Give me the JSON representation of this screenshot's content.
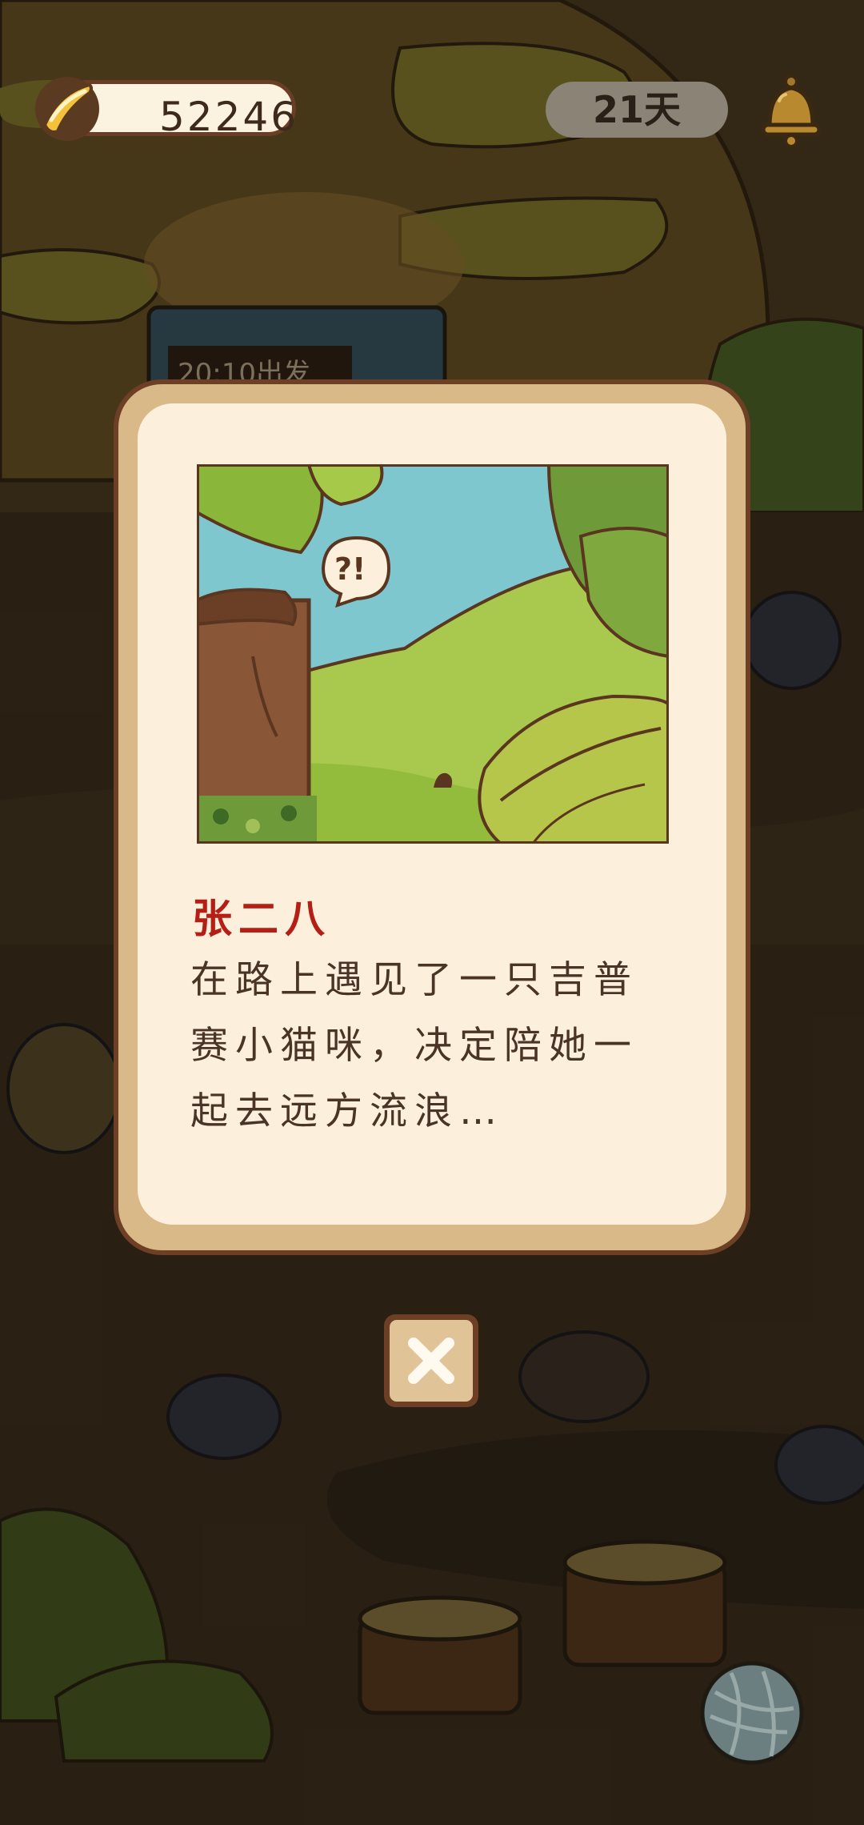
{
  "hud": {
    "banana_count": "52246",
    "days_label": "21天"
  },
  "background": {
    "partial_sign_text": "20:10出发"
  },
  "dialog": {
    "character_name": "张二八",
    "story_lines": [
      "在路上遇见了一只吉普",
      "赛小猫咪，决定陪她一",
      "起去远方流浪…"
    ],
    "speech_bubble_text": "?!"
  },
  "icons": {
    "banana": "banana-icon",
    "bell": "bell-icon",
    "close": "close-icon",
    "yarn": "yarn-ball-icon"
  },
  "colors": {
    "name_red": "#b51e14",
    "dialog_cream": "#fcf0dc",
    "border_brown": "#6d3f25"
  }
}
